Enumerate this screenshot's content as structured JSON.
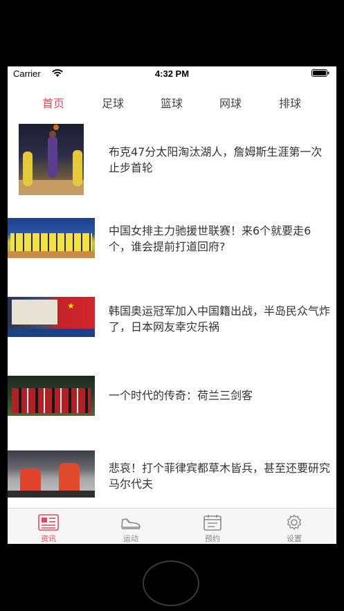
{
  "status": {
    "carrier": "Carrier",
    "time": "4:32 PM"
  },
  "tabs": [
    {
      "label": "首页",
      "active": true
    },
    {
      "label": "足球",
      "active": false
    },
    {
      "label": "篮球",
      "active": false
    },
    {
      "label": "网球",
      "active": false
    },
    {
      "label": "排球",
      "active": false
    }
  ],
  "news": [
    {
      "headline": "布克47分太阳淘汰湖人，詹姆斯生涯第一次止步首轮"
    },
    {
      "headline": "中国女排主力驰援世联赛！来6个就要走6个，谁会提前打道回府?"
    },
    {
      "headline": "韩国奥运冠军加入中国籍出战，半岛民众气炸了，日本网友幸灾乐祸"
    },
    {
      "headline": "一个时代的传奇：荷兰三剑客"
    },
    {
      "headline": "悲哀！打个菲律宾都草木皆兵，甚至还要研究马尔代夫"
    }
  ],
  "tabbar": [
    {
      "label": "资讯",
      "icon": "news-icon",
      "active": true
    },
    {
      "label": "运动",
      "icon": "sneaker-icon",
      "active": false
    },
    {
      "label": "预约",
      "icon": "calendar-icon",
      "active": false
    },
    {
      "label": "设置",
      "icon": "gear-icon",
      "active": false
    }
  ],
  "colors": {
    "accent": "#e24a5c",
    "inactive": "#888888"
  }
}
